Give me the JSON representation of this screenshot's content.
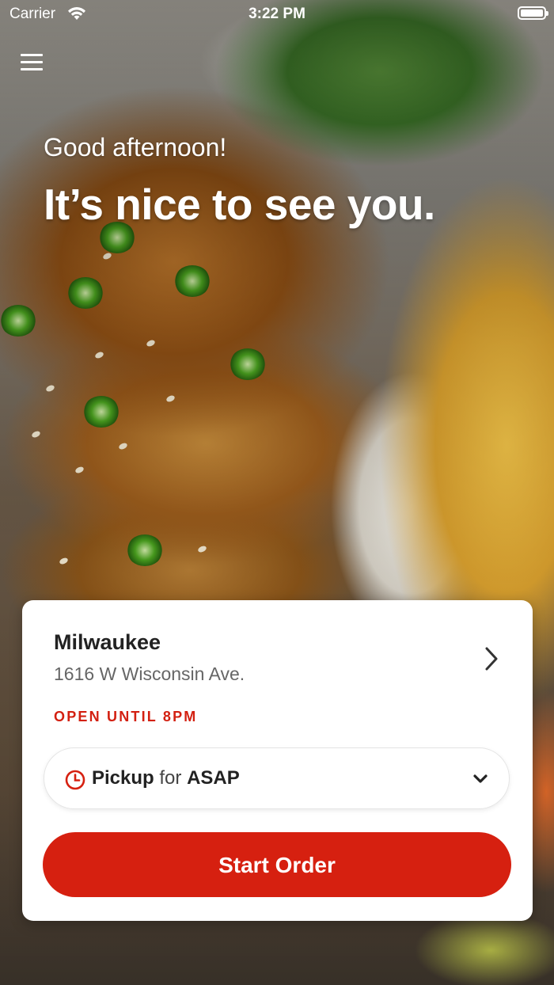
{
  "status_bar": {
    "carrier": "Carrier",
    "time": "3:22 PM"
  },
  "hero": {
    "greeting": "Good afternoon!",
    "headline": "It’s nice to see you."
  },
  "location": {
    "city": "Milwaukee",
    "address": "1616 W Wisconsin Ave.",
    "hours": "OPEN UNTIL 8PM"
  },
  "order_mode": {
    "mode": "Pickup",
    "connector": "for",
    "time": "ASAP"
  },
  "start_button": {
    "label": "Start Order"
  },
  "colors": {
    "accent": "#d62010",
    "hours_text": "#d32011"
  },
  "icons": [
    "menu-icon",
    "wifi-icon",
    "battery-icon",
    "chevron-right-icon",
    "clock-icon",
    "chevron-down-icon"
  ]
}
